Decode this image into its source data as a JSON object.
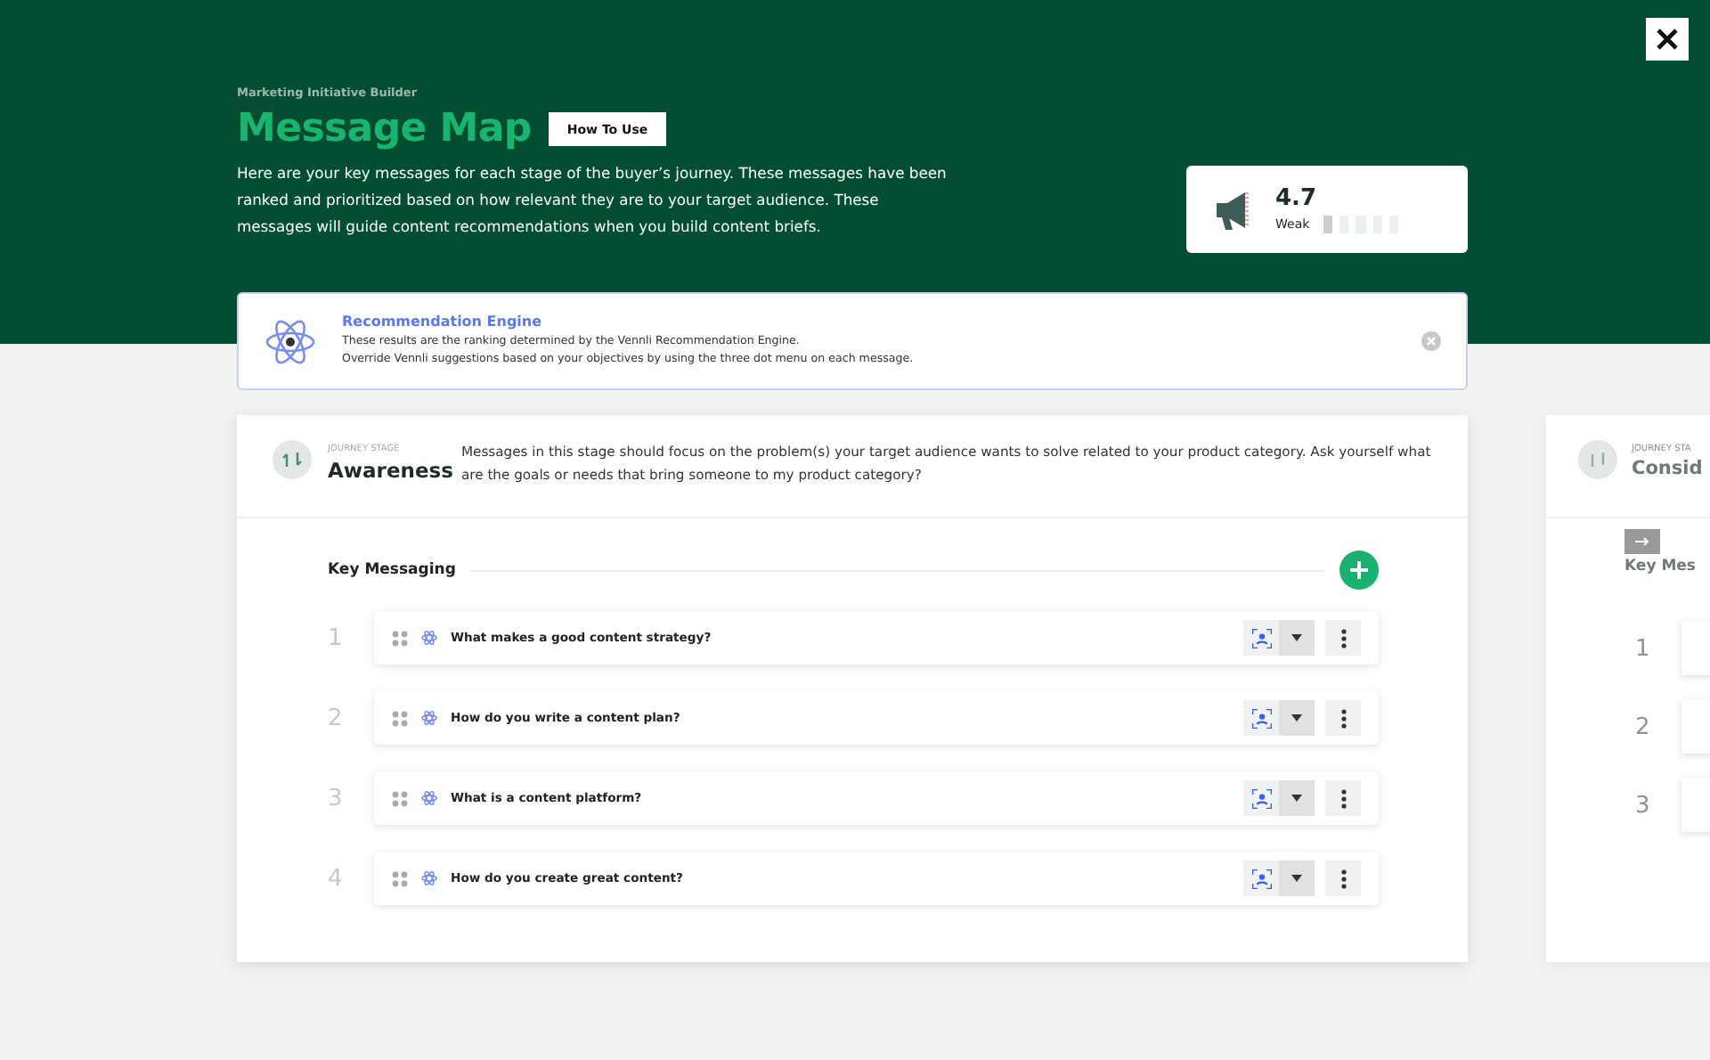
{
  "header": {
    "eyebrow": "Marketing Initiative Builder",
    "title": "Message Map",
    "how_to_button": "How To Use",
    "description": "Here are your key messages for each stage of the buyer’s journey. These messages have been ranked and prioritized based on how relevant they are to your target audience. These messages will guide content recommendations when you build content briefs."
  },
  "score": {
    "value": "4.7",
    "rating": "Weak",
    "level": 0.2
  },
  "recommendation": {
    "title": "Recommendation Engine",
    "lines": [
      "These results are the ranking determined by the Vennli Recommendation Engine.",
      "Override Vennli suggestions based on your objectives by using the three dot menu on each message."
    ]
  },
  "stage": {
    "eyebrow": "JOURNEY STAGE",
    "name": "Awareness",
    "description": "Messages in this stage should focus on the problem(s) your target audience wants to solve related to your product category. Ask yourself what are the goals or needs that bring someone to my product category?",
    "section_title": "Key Messaging",
    "messages": [
      {
        "rank": "1",
        "text": "What makes a good content strategy?"
      },
      {
        "rank": "2",
        "text": "How do you write a content plan?"
      },
      {
        "rank": "3",
        "text": "What is a content platform?"
      },
      {
        "rank": "4",
        "text": "How do you create great content?"
      }
    ]
  },
  "next_stage": {
    "eyebrow": "JOURNEY STA",
    "name": "Consid",
    "section_title": "Key Mes",
    "ranks": [
      "1",
      "2",
      "3"
    ]
  }
}
